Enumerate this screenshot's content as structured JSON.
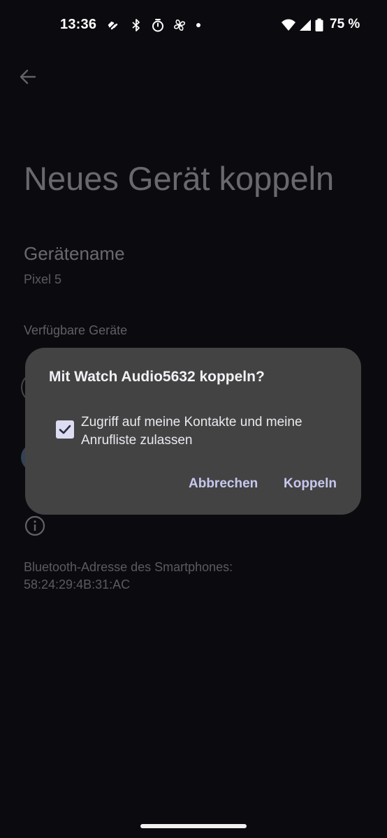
{
  "status_bar": {
    "time": "13:36",
    "icons_left": [
      "link-icon",
      "bluetooth-icon",
      "timer-icon",
      "fan-icon",
      "dot-icon"
    ],
    "icons_right": [
      "wifi-icon",
      "cell-signal-icon",
      "battery-icon"
    ],
    "battery_text": "75 %"
  },
  "page": {
    "title": "Neues Gerät koppeln",
    "device_name_label": "Gerätename",
    "device_name_value": "Pixel 5",
    "available_devices_header": "Verfügbare Geräte",
    "bt_address_label": "Bluetooth-Adresse des Smartphones:",
    "bt_address_value": "58:24:29:4B:31:AC"
  },
  "dialog": {
    "title": "Mit Watch Audio5632 koppeln?",
    "checkbox_checked": true,
    "checkbox_label": "Zugriff auf meine Kontakte und meine Anrufliste zulassen",
    "cancel_label": "Abbrechen",
    "pair_label": "Koppeln"
  },
  "colors": {
    "background": "#0b0b0f",
    "dialog_background": "#434344",
    "accent": "#c7c8ee",
    "checkbox_fill": "#dcdcf2"
  }
}
